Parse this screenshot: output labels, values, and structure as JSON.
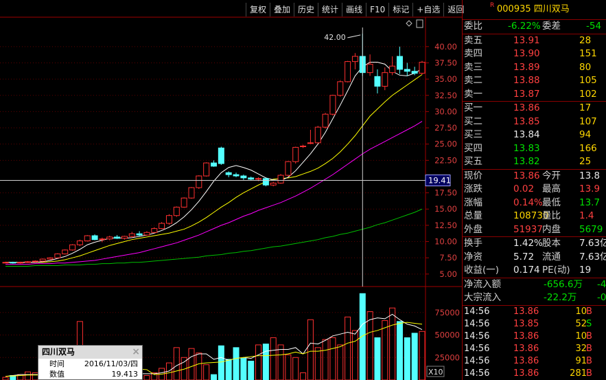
{
  "toolbar": {
    "buttons": [
      "复权",
      "叠加",
      "历史",
      "统计",
      "画线",
      "F10",
      "标记",
      "+自选",
      "返回"
    ]
  },
  "chart": {
    "peak_label": "42.00",
    "price_axis": [
      "40.00",
      "37.50",
      "35.00",
      "32.50",
      "30.00",
      "27.50",
      "25.00",
      "22.50",
      "17.50",
      "15.00",
      "12.50",
      "10.00",
      "7.50",
      "5.00"
    ],
    "cursor_value": "19.41",
    "volume_axis": [
      "75000",
      "50000",
      "25000"
    ],
    "volume_unit": "X10"
  },
  "chart_data": {
    "type": "candlestick",
    "ylim": [
      3.5,
      44
    ],
    "candles": [
      [
        6.8,
        6.9,
        6.7,
        6.8
      ],
      [
        6.8,
        6.9,
        6.6,
        6.7
      ],
      [
        6.7,
        6.9,
        6.6,
        6.8
      ],
      [
        6.8,
        7.0,
        6.7,
        6.9
      ],
      [
        6.9,
        7.1,
        6.8,
        7.0
      ],
      [
        7.0,
        7.4,
        6.9,
        7.3
      ],
      [
        7.3,
        7.6,
        7.2,
        7.5
      ],
      [
        7.5,
        8.2,
        7.4,
        8.1
      ],
      [
        8.1,
        8.8,
        8.0,
        8.7
      ],
      [
        8.7,
        9.6,
        8.6,
        9.5
      ],
      [
        9.5,
        10.3,
        9.3,
        10.1
      ],
      [
        10.1,
        11.0,
        10.0,
        10.9
      ],
      [
        10.9,
        11.1,
        10.2,
        10.3
      ],
      [
        10.3,
        10.6,
        9.9,
        10.4
      ],
      [
        10.4,
        10.9,
        10.2,
        10.7
      ],
      [
        10.7,
        11.0,
        10.4,
        10.5
      ],
      [
        10.5,
        10.9,
        10.3,
        10.8
      ],
      [
        10.8,
        11.5,
        10.6,
        11.2
      ],
      [
        11.2,
        11.6,
        10.8,
        11.0
      ],
      [
        11.0,
        11.6,
        10.9,
        11.4
      ],
      [
        11.4,
        12.2,
        11.3,
        12.0
      ],
      [
        12.0,
        13.0,
        11.9,
        12.8
      ],
      [
        12.8,
        14.2,
        12.6,
        14.0
      ],
      [
        14.0,
        15.4,
        13.8,
        15.3
      ],
      [
        15.3,
        16.8,
        15.2,
        16.7
      ],
      [
        16.7,
        18.4,
        16.6,
        18.3
      ],
      [
        18.3,
        20.2,
        18.1,
        20.1
      ],
      [
        20.1,
        22.2,
        20.0,
        22.1
      ],
      [
        22.1,
        22.5,
        21.5,
        21.6
      ],
      [
        24.4,
        24.6,
        21.8,
        22.0
      ],
      [
        20.6,
        20.8,
        19.9,
        20.3
      ],
      [
        20.3,
        20.6,
        19.9,
        20.1
      ],
      [
        20.1,
        20.3,
        19.5,
        19.8
      ],
      [
        19.8,
        20.0,
        19.4,
        19.6
      ],
      [
        19.6,
        19.9,
        19.3,
        19.7
      ],
      [
        19.7,
        19.8,
        18.5,
        18.7
      ],
      [
        18.7,
        19.2,
        18.5,
        19.0
      ],
      [
        19.0,
        20.4,
        18.9,
        20.2
      ],
      [
        20.2,
        22.4,
        20.0,
        22.3
      ],
      [
        22.3,
        24.6,
        22.0,
        24.5
      ],
      [
        24.6,
        24.9,
        24.4,
        24.7
      ],
      [
        25.1,
        27.2,
        25.0,
        25.2
      ],
      [
        25.2,
        27.8,
        25.1,
        27.6
      ],
      [
        27.6,
        29.8,
        27.4,
        29.6
      ],
      [
        29.6,
        32.6,
        29.4,
        32.5
      ],
      [
        32.5,
        34.8,
        32.3,
        34.6
      ],
      [
        34.6,
        37.8,
        34.5,
        37.7
      ],
      [
        37.7,
        39.0,
        36.5,
        38.5
      ],
      [
        38.5,
        42.0,
        35.5,
        36.0
      ],
      [
        36.0,
        38.8,
        35.5,
        37.3
      ],
      [
        35.4,
        36.5,
        32.8,
        33.9
      ],
      [
        33.9,
        36.8,
        33.3,
        36.0
      ],
      [
        36.0,
        38.5,
        35.6,
        37.0
      ],
      [
        38.5,
        40.0,
        35.8,
        36.5
      ],
      [
        36.5,
        37.5,
        35.5,
        36.2
      ],
      [
        36.2,
        36.9,
        35.6,
        35.9
      ],
      [
        35.9,
        37.8,
        35.7,
        37.6
      ]
    ],
    "ma5": [
      6.8,
      6.8,
      6.8,
      6.8,
      6.8,
      6.9,
      7.1,
      7.4,
      7.7,
      8.2,
      8.8,
      9.5,
      9.9,
      10.2,
      10.5,
      10.6,
      10.5,
      10.6,
      10.8,
      11.0,
      11.3,
      11.7,
      12.2,
      12.9,
      13.8,
      14.9,
      16.2,
      17.7,
      19.3,
      20.6,
      21.4,
      21.7,
      21.4,
      21.0,
      20.4,
      19.8,
      19.5,
      19.4,
      19.9,
      20.9,
      22.2,
      23.5,
      25.0,
      26.8,
      28.9,
      31.0,
      33.2,
      35.5,
      36.9,
      37.6,
      37.6,
      37.3,
      36.2,
      35.6,
      35.5,
      35.9,
      36.6
    ],
    "ma10": [
      6.8,
      6.8,
      6.8,
      6.8,
      6.8,
      6.8,
      6.9,
      7.0,
      7.2,
      7.5,
      7.8,
      8.2,
      8.6,
      9.0,
      9.4,
      9.7,
      10.0,
      10.3,
      10.5,
      10.7,
      10.9,
      11.1,
      11.3,
      11.6,
      11.9,
      12.4,
      13.0,
      13.7,
      14.5,
      15.3,
      16.0,
      16.8,
      17.5,
      18.1,
      18.7,
      19.2,
      19.6,
      19.7,
      19.8,
      20.0,
      20.4,
      20.8,
      21.3,
      22.0,
      22.8,
      23.8,
      25.0,
      26.3,
      27.8,
      29.3,
      30.4,
      31.5,
      32.5,
      33.3,
      34.1,
      34.9,
      35.7
    ],
    "ma20": [
      6.5,
      6.5,
      6.5,
      6.5,
      6.6,
      6.6,
      6.6,
      6.7,
      6.7,
      6.8,
      6.9,
      7.0,
      7.1,
      7.3,
      7.5,
      7.7,
      7.9,
      8.1,
      8.3,
      8.6,
      8.9,
      9.2,
      9.5,
      9.8,
      10.2,
      10.6,
      11.0,
      11.5,
      12.0,
      12.5,
      12.9,
      13.4,
      13.9,
      14.3,
      14.8,
      15.2,
      15.6,
      16.0,
      16.5,
      17.0,
      17.6,
      18.2,
      18.9,
      19.6,
      20.3,
      21.1,
      21.9,
      22.7,
      23.5,
      24.2,
      24.8,
      25.4,
      26.0,
      26.6,
      27.2,
      27.8,
      28.5
    ],
    "ma60": [
      6.2,
      6.2,
      6.2,
      6.2,
      6.3,
      6.3,
      6.3,
      6.3,
      6.4,
      6.4,
      6.4,
      6.5,
      6.5,
      6.6,
      6.6,
      6.7,
      6.7,
      6.8,
      6.8,
      6.9,
      7.0,
      7.1,
      7.2,
      7.3,
      7.4,
      7.5,
      7.6,
      7.8,
      7.9,
      8.0,
      8.2,
      8.3,
      8.5,
      8.6,
      8.8,
      9.0,
      9.2,
      9.3,
      9.5,
      9.7,
      9.9,
      10.1,
      10.3,
      10.6,
      10.8,
      11.1,
      11.3,
      11.6,
      11.9,
      12.2,
      12.6,
      12.9,
      13.3,
      13.7,
      14.1,
      14.5,
      15.0
    ],
    "volumes": [
      3000,
      5000,
      6000,
      9000,
      8000,
      3000,
      8000,
      5000,
      12000,
      1000,
      65000,
      3000,
      1000,
      1000,
      10000,
      5000,
      9000,
      8000,
      6000,
      5000,
      8000,
      13000,
      19000,
      36000,
      25000,
      35000,
      30000,
      17000,
      6000,
      38000,
      23000,
      36000,
      24000,
      21000,
      39000,
      40000,
      47000,
      39000,
      28000,
      25000,
      8000,
      67000,
      36000,
      45000,
      47000,
      39000,
      70000,
      55000,
      96000,
      76000,
      47000,
      66000,
      80000,
      65000,
      47000,
      52000,
      54000
    ],
    "vol_ma5": [
      4000,
      5000,
      6000,
      6000,
      6000,
      6000,
      7000,
      7000,
      8000,
      6000,
      18000,
      18000,
      18000,
      16000,
      16000,
      4000,
      5000,
      6000,
      7000,
      7000,
      7000,
      8000,
      10000,
      16000,
      20000,
      26000,
      29000,
      29000,
      23000,
      25000,
      22000,
      24000,
      25000,
      24000,
      28000,
      32000,
      33000,
      34000,
      34000,
      36000,
      29000,
      41000,
      40000,
      44000,
      49000,
      51000,
      53000,
      51000,
      62000,
      67000,
      69000,
      68000,
      73000,
      67000,
      62000,
      60000,
      56000
    ],
    "vol_ma10": [
      4000,
      4500,
      5000,
      5500,
      5500,
      5500,
      6000,
      6500,
      7000,
      7000,
      12000,
      12000,
      12000,
      11000,
      11000,
      11000,
      11500,
      12000,
      12000,
      11500,
      6000,
      6500,
      8000,
      10000,
      12000,
      15000,
      18000,
      19000,
      19500,
      20000,
      22000,
      24000,
      25000,
      26000,
      27000,
      27000,
      27500,
      28000,
      29000,
      31000,
      29000,
      32000,
      32000,
      33000,
      35000,
      37000,
      41000,
      43000,
      49000,
      53000,
      55000,
      58000,
      61000,
      63000,
      64000,
      63000,
      62000
    ],
    "vol_ylim": [
      0,
      100000
    ]
  },
  "popup": {
    "title": "四川双马",
    "row1_label": "时间",
    "row1_value": "2016/11/03/四",
    "row2_label": "数值",
    "row2_value": "19.413"
  },
  "quote": {
    "r_mark": "R",
    "code": "000935",
    "name": "四川双马",
    "weibi_label": "委比",
    "weibi_value": "-6.22%",
    "weicha_label": "委差",
    "weicha_value": "-54",
    "asks": [
      {
        "label": "卖五",
        "price": "13.91",
        "vol": "28"
      },
      {
        "label": "卖四",
        "price": "13.90",
        "vol": "151"
      },
      {
        "label": "卖三",
        "price": "13.89",
        "vol": "80"
      },
      {
        "label": "卖二",
        "price": "13.88",
        "vol": "105"
      },
      {
        "label": "卖一",
        "price": "13.87",
        "vol": "102"
      }
    ],
    "bids": [
      {
        "label": "买一",
        "price": "13.86",
        "vol": "17",
        "pc": "red"
      },
      {
        "label": "买二",
        "price": "13.85",
        "vol": "107",
        "pc": "red"
      },
      {
        "label": "买三",
        "price": "13.84",
        "vol": "94",
        "pc": "white"
      },
      {
        "label": "买四",
        "price": "13.83",
        "vol": "166",
        "pc": "green"
      },
      {
        "label": "买五",
        "price": "13.82",
        "vol": "25",
        "pc": "green"
      }
    ],
    "stats": [
      {
        "l1": "现价",
        "v1": "13.86",
        "c1": "red",
        "l2": "今开",
        "v2": "13.8",
        "c2": "white"
      },
      {
        "l1": "涨跌",
        "v1": "0.02",
        "c1": "red",
        "l2": "最高",
        "v2": "13.9",
        "c2": "red"
      },
      {
        "l1": "涨幅",
        "v1": "0.14%",
        "c1": "red",
        "l2": "最低",
        "v2": "13.7",
        "c2": "green"
      },
      {
        "l1": "总量",
        "v1": "108730",
        "c1": "yellow",
        "l2": "量比",
        "v2": "1.4",
        "c2": "red"
      },
      {
        "l1": "外盘",
        "v1": "51937",
        "c1": "red",
        "l2": "内盘",
        "v2": "5679",
        "c2": "green"
      }
    ],
    "stats2": [
      {
        "l1": "换手",
        "v1": "1.42%",
        "c1": "white",
        "l2": "股本",
        "v2": "7.63亿",
        "c2": "white"
      },
      {
        "l1": "净资",
        "v1": "5.72",
        "c1": "white",
        "l2": "流通",
        "v2": "7.63亿",
        "c2": "white"
      },
      {
        "l1": "收益(一)",
        "v1": "0.174",
        "c1": "white",
        "l2": "PE(动)",
        "v2": "19",
        "c2": "white"
      }
    ],
    "flow": [
      {
        "label": "净流入额",
        "value": "-656.6万",
        "extra": "-4"
      },
      {
        "label": "大宗流入",
        "value": "-22.2万",
        "extra": "-0"
      }
    ],
    "ticks": [
      {
        "time": "14:56",
        "price": "13.86",
        "pc": "red",
        "vol": "10",
        "vc": "yellow",
        "dir": "B",
        "dc": "red"
      },
      {
        "time": "14:56",
        "price": "13.85",
        "pc": "red",
        "vol": "52",
        "vc": "yellow",
        "dir": "S",
        "dc": "green"
      },
      {
        "time": "14:56",
        "price": "13.86",
        "pc": "red",
        "vol": "10",
        "vc": "yellow",
        "dir": "B",
        "dc": "red"
      },
      {
        "time": "14:56",
        "price": "13.86",
        "pc": "red",
        "vol": "32",
        "vc": "yellow",
        "dir": "B",
        "dc": "red"
      },
      {
        "time": "14:56",
        "price": "13.86",
        "pc": "red",
        "vol": "91",
        "vc": "yellow",
        "dir": "B",
        "dc": "red"
      },
      {
        "time": "14:56",
        "price": "13.86",
        "pc": "red",
        "vol": "281",
        "vc": "yellow",
        "dir": "B",
        "dc": "red"
      }
    ]
  }
}
